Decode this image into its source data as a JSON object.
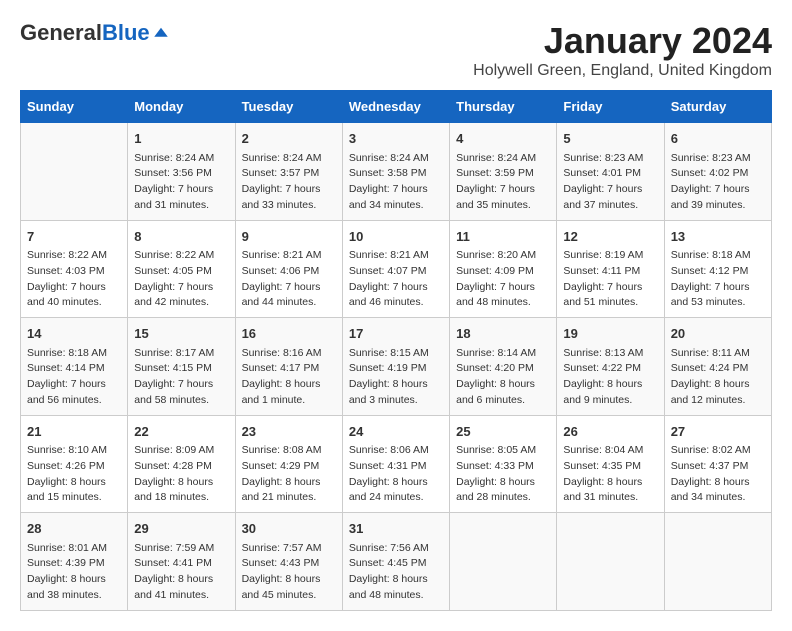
{
  "logo": {
    "general": "General",
    "blue": "Blue"
  },
  "header": {
    "month": "January 2024",
    "location": "Holywell Green, England, United Kingdom"
  },
  "days_of_week": [
    "Sunday",
    "Monday",
    "Tuesday",
    "Wednesday",
    "Thursday",
    "Friday",
    "Saturday"
  ],
  "weeks": [
    [
      {
        "day": "",
        "content": ""
      },
      {
        "day": "1",
        "content": "Sunrise: 8:24 AM\nSunset: 3:56 PM\nDaylight: 7 hours\nand 31 minutes."
      },
      {
        "day": "2",
        "content": "Sunrise: 8:24 AM\nSunset: 3:57 PM\nDaylight: 7 hours\nand 33 minutes."
      },
      {
        "day": "3",
        "content": "Sunrise: 8:24 AM\nSunset: 3:58 PM\nDaylight: 7 hours\nand 34 minutes."
      },
      {
        "day": "4",
        "content": "Sunrise: 8:24 AM\nSunset: 3:59 PM\nDaylight: 7 hours\nand 35 minutes."
      },
      {
        "day": "5",
        "content": "Sunrise: 8:23 AM\nSunset: 4:01 PM\nDaylight: 7 hours\nand 37 minutes."
      },
      {
        "day": "6",
        "content": "Sunrise: 8:23 AM\nSunset: 4:02 PM\nDaylight: 7 hours\nand 39 minutes."
      }
    ],
    [
      {
        "day": "7",
        "content": "Sunrise: 8:22 AM\nSunset: 4:03 PM\nDaylight: 7 hours\nand 40 minutes."
      },
      {
        "day": "8",
        "content": "Sunrise: 8:22 AM\nSunset: 4:05 PM\nDaylight: 7 hours\nand 42 minutes."
      },
      {
        "day": "9",
        "content": "Sunrise: 8:21 AM\nSunset: 4:06 PM\nDaylight: 7 hours\nand 44 minutes."
      },
      {
        "day": "10",
        "content": "Sunrise: 8:21 AM\nSunset: 4:07 PM\nDaylight: 7 hours\nand 46 minutes."
      },
      {
        "day": "11",
        "content": "Sunrise: 8:20 AM\nSunset: 4:09 PM\nDaylight: 7 hours\nand 48 minutes."
      },
      {
        "day": "12",
        "content": "Sunrise: 8:19 AM\nSunset: 4:11 PM\nDaylight: 7 hours\nand 51 minutes."
      },
      {
        "day": "13",
        "content": "Sunrise: 8:18 AM\nSunset: 4:12 PM\nDaylight: 7 hours\nand 53 minutes."
      }
    ],
    [
      {
        "day": "14",
        "content": "Sunrise: 8:18 AM\nSunset: 4:14 PM\nDaylight: 7 hours\nand 56 minutes."
      },
      {
        "day": "15",
        "content": "Sunrise: 8:17 AM\nSunset: 4:15 PM\nDaylight: 7 hours\nand 58 minutes."
      },
      {
        "day": "16",
        "content": "Sunrise: 8:16 AM\nSunset: 4:17 PM\nDaylight: 8 hours\nand 1 minute."
      },
      {
        "day": "17",
        "content": "Sunrise: 8:15 AM\nSunset: 4:19 PM\nDaylight: 8 hours\nand 3 minutes."
      },
      {
        "day": "18",
        "content": "Sunrise: 8:14 AM\nSunset: 4:20 PM\nDaylight: 8 hours\nand 6 minutes."
      },
      {
        "day": "19",
        "content": "Sunrise: 8:13 AM\nSunset: 4:22 PM\nDaylight: 8 hours\nand 9 minutes."
      },
      {
        "day": "20",
        "content": "Sunrise: 8:11 AM\nSunset: 4:24 PM\nDaylight: 8 hours\nand 12 minutes."
      }
    ],
    [
      {
        "day": "21",
        "content": "Sunrise: 8:10 AM\nSunset: 4:26 PM\nDaylight: 8 hours\nand 15 minutes."
      },
      {
        "day": "22",
        "content": "Sunrise: 8:09 AM\nSunset: 4:28 PM\nDaylight: 8 hours\nand 18 minutes."
      },
      {
        "day": "23",
        "content": "Sunrise: 8:08 AM\nSunset: 4:29 PM\nDaylight: 8 hours\nand 21 minutes."
      },
      {
        "day": "24",
        "content": "Sunrise: 8:06 AM\nSunset: 4:31 PM\nDaylight: 8 hours\nand 24 minutes."
      },
      {
        "day": "25",
        "content": "Sunrise: 8:05 AM\nSunset: 4:33 PM\nDaylight: 8 hours\nand 28 minutes."
      },
      {
        "day": "26",
        "content": "Sunrise: 8:04 AM\nSunset: 4:35 PM\nDaylight: 8 hours\nand 31 minutes."
      },
      {
        "day": "27",
        "content": "Sunrise: 8:02 AM\nSunset: 4:37 PM\nDaylight: 8 hours\nand 34 minutes."
      }
    ],
    [
      {
        "day": "28",
        "content": "Sunrise: 8:01 AM\nSunset: 4:39 PM\nDaylight: 8 hours\nand 38 minutes."
      },
      {
        "day": "29",
        "content": "Sunrise: 7:59 AM\nSunset: 4:41 PM\nDaylight: 8 hours\nand 41 minutes."
      },
      {
        "day": "30",
        "content": "Sunrise: 7:57 AM\nSunset: 4:43 PM\nDaylight: 8 hours\nand 45 minutes."
      },
      {
        "day": "31",
        "content": "Sunrise: 7:56 AM\nSunset: 4:45 PM\nDaylight: 8 hours\nand 48 minutes."
      },
      {
        "day": "",
        "content": ""
      },
      {
        "day": "",
        "content": ""
      },
      {
        "day": "",
        "content": ""
      }
    ]
  ]
}
